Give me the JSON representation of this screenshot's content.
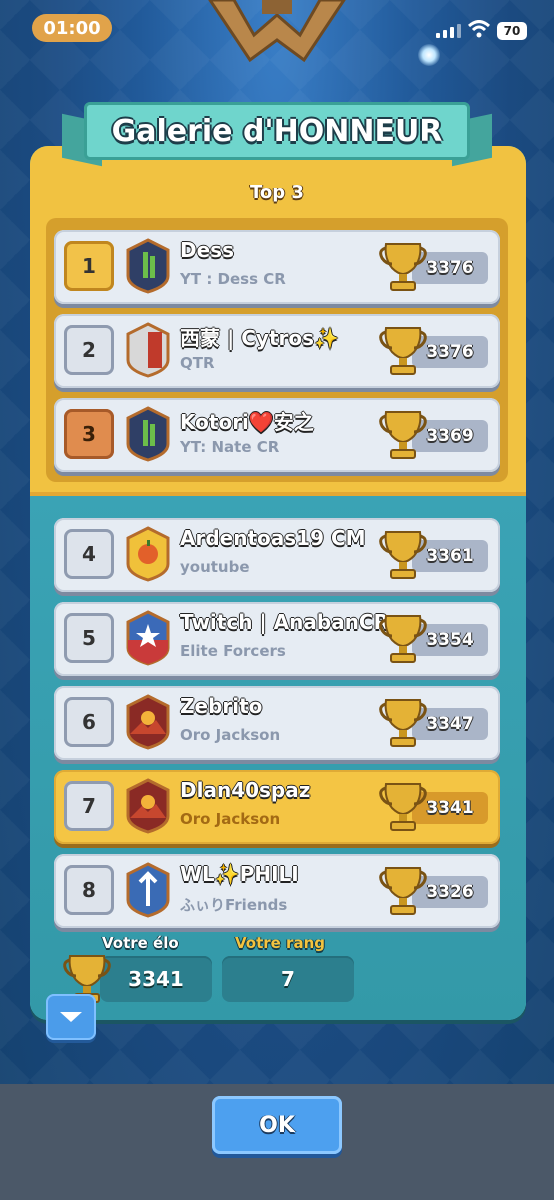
{
  "status_bar": {
    "time": "01:00",
    "battery": "70"
  },
  "header": {
    "title": "Galerie d'HONNEUR"
  },
  "top_section": {
    "label": "Top 3"
  },
  "players": [
    {
      "rank": "1",
      "name": "Dess",
      "clan": "YT : Dess CR",
      "score": "3376",
      "badge": "bamboo",
      "rank_style": "gold"
    },
    {
      "rank": "2",
      "name": "西蒙 | Cytros✨",
      "clan": "QTR",
      "score": "3376",
      "badge": "red-shield",
      "rank_style": "silver"
    },
    {
      "rank": "3",
      "name": "Kotori❤️安之",
      "clan": "YT: Nate CR",
      "score": "3369",
      "badge": "bamboo",
      "rank_style": "bronze"
    },
    {
      "rank": "4",
      "name": "Ardentoas19 CM",
      "clan": "youtube",
      "score": "3361",
      "badge": "orange-fruit",
      "rank_style": "silver"
    },
    {
      "rank": "5",
      "name": "Twitch | AnabanCR",
      "clan": "Elite Forcers",
      "score": "3354",
      "badge": "star-shield",
      "rank_style": "silver"
    },
    {
      "rank": "6",
      "name": "Zebrito",
      "clan": "Oro Jackson",
      "score": "3347",
      "badge": "sunset-mountain",
      "rank_style": "silver"
    },
    {
      "rank": "7",
      "name": "Dlan40spaz",
      "clan": "Oro Jackson",
      "score": "3341",
      "badge": "sunset-mountain",
      "rank_style": "silver",
      "is_me": true
    },
    {
      "rank": "8",
      "name": "WL✨PHILI",
      "clan": "ふぃりFriends",
      "score": "3326",
      "badge": "arrow-shield",
      "rank_style": "silver"
    }
  ],
  "summary": {
    "elo_label": "Votre élo",
    "elo_value": "3341",
    "rank_label": "Votre rang",
    "rank_value": "7"
  },
  "ok_label": "OK",
  "colors": {
    "gold_panel": "#f1c241",
    "teal_panel": "#3d9fb0",
    "highlight_row": "#f4c544",
    "button_blue": "#4da0ef"
  }
}
